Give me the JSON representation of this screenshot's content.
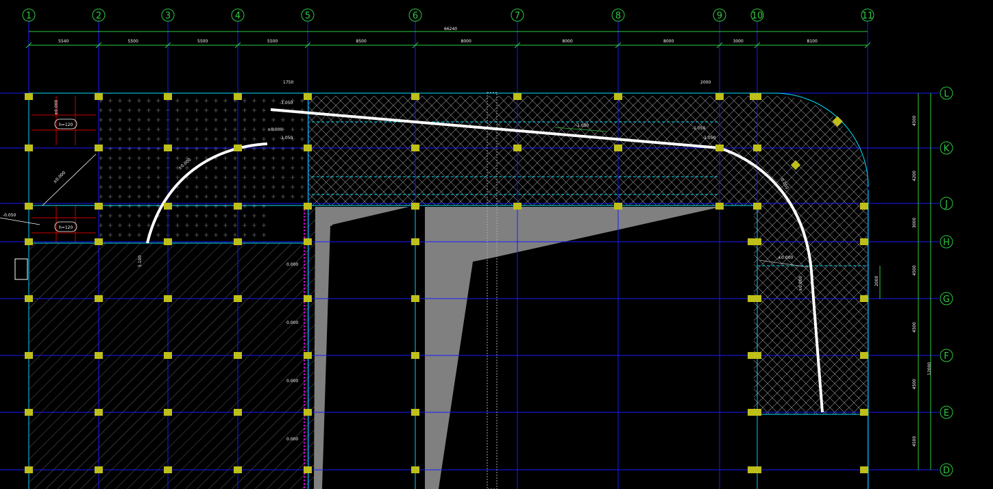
{
  "drawing": {
    "colors": {
      "background": "#000000",
      "grid_axis": "#1a1aff",
      "bubble": "#2ecc40",
      "dimension": "#2ecc40",
      "slab_edge": "#00e5ff",
      "column": "#bfbf1a",
      "opening_fill": "#808080",
      "beam_white": "#ffffff",
      "hatch": "#9a9a9a",
      "red_bay": "#cc0000",
      "magenta": "#ff00ff"
    },
    "column_axes": [
      "1",
      "2",
      "3",
      "4",
      "5",
      "6",
      "7",
      "8",
      "9",
      "10",
      "11"
    ],
    "row_axes": [
      "L",
      "K",
      "J",
      "H",
      "G",
      "F",
      "E",
      "D"
    ],
    "overall_dimension": "66240",
    "top_dimensions": [
      "5540",
      "5500",
      "5500",
      "5500",
      "8500",
      "8000",
      "8000",
      "8000",
      "3000",
      "8100"
    ],
    "right_dimensions": [
      "4500",
      "4200",
      "3000",
      "4500",
      "4500",
      "4500",
      "4500"
    ],
    "right_overall_dimension": "12000",
    "right_sub_dimension": "2000",
    "small_dims": [
      "1750",
      "2000"
    ],
    "annotations": {
      "slab_thickness_1": "h=120",
      "slab_thickness_2": "h=120",
      "red_note_1": "±0.000",
      "red_note_2": "±0.000",
      "left_note": "-0.050",
      "diag_note": "±0.000",
      "beam_note_1": "-1.050",
      "beam_note_2": "-1.050",
      "beam_note_3": "-1.050",
      "beam_note_4": "-1.050",
      "slope_note_1": "-1.050",
      "slope_note_2": "±0.000",
      "arc_note": "±0.000",
      "arc_end": "5.100",
      "right_note_1": "±0.000",
      "right_note_2": "-0.050",
      "right_note_3": "±0.000",
      "magenta_notes": [
        "0.000",
        "0.000",
        "0.000",
        "0.000"
      ]
    }
  }
}
